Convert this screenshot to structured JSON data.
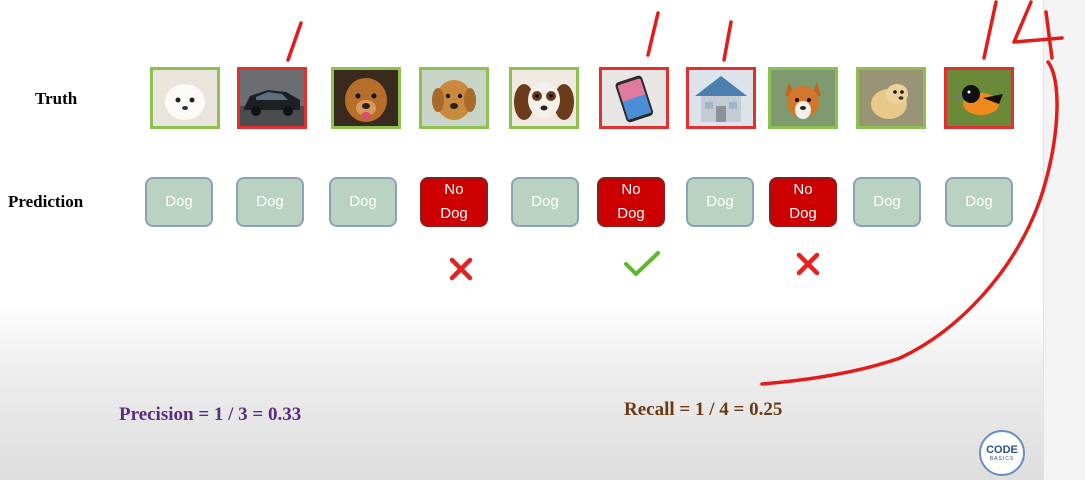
{
  "rows": {
    "truth_label": "Truth",
    "prediction_label": "Prediction"
  },
  "items": [
    {
      "truth_subject": "white puppy",
      "truth_class": "dog",
      "prediction_line1": "Dog",
      "prediction_line2": ""
    },
    {
      "truth_subject": "car",
      "truth_class": "not-dog",
      "prediction_line1": "Dog",
      "prediction_line2": ""
    },
    {
      "truth_subject": "golden retriever",
      "truth_class": "dog",
      "prediction_line1": "Dog",
      "prediction_line2": ""
    },
    {
      "truth_subject": "retriever dog",
      "truth_class": "dog",
      "prediction_line1": "No",
      "prediction_line2": "Dog"
    },
    {
      "truth_subject": "spaniel dog",
      "truth_class": "dog",
      "prediction_line1": "Dog",
      "prediction_line2": ""
    },
    {
      "truth_subject": "smartphone",
      "truth_class": "not-dog",
      "prediction_line1": "No",
      "prediction_line2": "Dog"
    },
    {
      "truth_subject": "house",
      "truth_class": "not-dog",
      "prediction_line1": "Dog",
      "prediction_line2": ""
    },
    {
      "truth_subject": "corgi dog",
      "truth_class": "dog",
      "prediction_line1": "No",
      "prediction_line2": "Dog"
    },
    {
      "truth_subject": "puppy",
      "truth_class": "dog",
      "prediction_line1": "Dog",
      "prediction_line2": ""
    },
    {
      "truth_subject": "bird",
      "truth_class": "not-dog",
      "prediction_line1": "Dog",
      "prediction_line2": ""
    }
  ],
  "evaluation_marks": [
    {
      "under_item": 4,
      "type": "cross-icon"
    },
    {
      "under_item": 6,
      "type": "check-icon"
    },
    {
      "under_item": 8,
      "type": "cross-icon"
    }
  ],
  "formulas": {
    "precision": "Precision = 1 / 3 = 0.33",
    "recall": "Recall = 1 / 4 = 0.25"
  },
  "annotation": {
    "handwritten": "4"
  },
  "logo": {
    "line1": "CODE",
    "line2": "BASICS"
  },
  "colors": {
    "truth_dog_border": "#8cc152",
    "truth_not_dog_border": "#e03030",
    "prediction_dog_bg": "#b9d2c2",
    "prediction_no_dog_bg": "#cc0000",
    "precision_text": "#5b2d82",
    "recall_text": "#6b3a10",
    "annotation_ink": "#e21b1b",
    "check": "#5cb82e",
    "cross": "#e52222"
  }
}
